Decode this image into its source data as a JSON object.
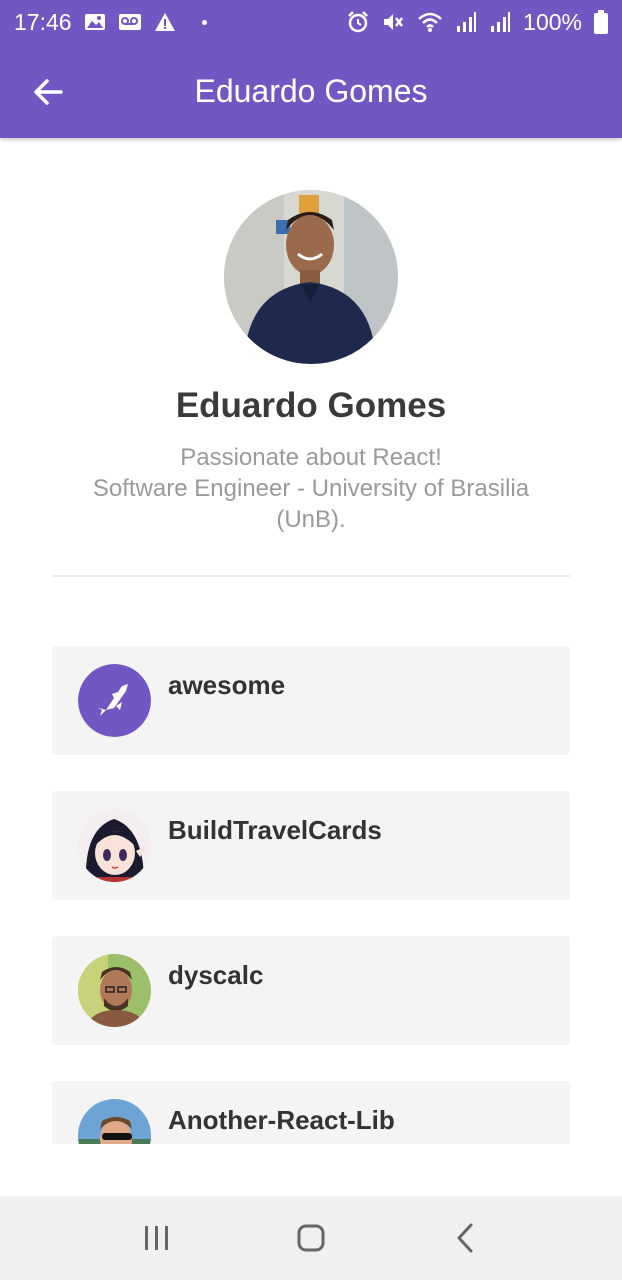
{
  "status_bar": {
    "time": "17:46",
    "battery": "100%",
    "left_icons": [
      "gallery-icon",
      "voicemail-icon",
      "warning-icon",
      "dot-icon"
    ],
    "right_icons": [
      "alarm-icon",
      "mute-icon",
      "wifi-icon",
      "signal-icon",
      "signal-icon",
      "battery-icon"
    ]
  },
  "app_bar": {
    "title": "Eduardo Gomes",
    "back_icon": "arrow-left-icon",
    "color": "#7257c2"
  },
  "profile": {
    "name": "Eduardo Gomes",
    "bio_line1": "Passionate about React!",
    "bio_line2": "Software Engineer - University of Brasilia",
    "bio_line3": "(UnB)."
  },
  "repos": [
    {
      "name": "awesome",
      "avatar": "rocket-icon"
    },
    {
      "name": "BuildTravelCards",
      "avatar": "anime-avatar"
    },
    {
      "name": "dyscalc",
      "avatar": "person-avatar"
    },
    {
      "name": "Another-React-Lib",
      "avatar": "person-avatar"
    }
  ],
  "nav_bar": {
    "buttons": [
      "recents-icon",
      "home-icon",
      "back-icon"
    ]
  }
}
